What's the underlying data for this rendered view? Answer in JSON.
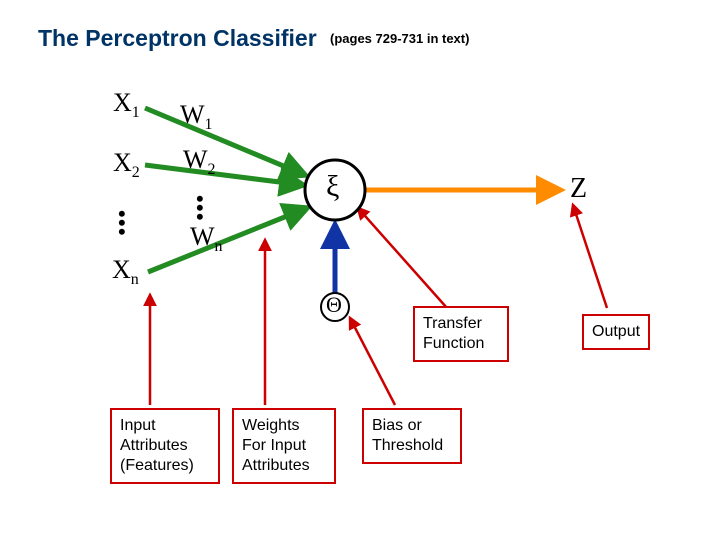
{
  "title": "The Perceptron Classifier",
  "subtitle": "(pages 729-731 in text)",
  "inputs": {
    "x1": "X",
    "x1_sub": "1",
    "x2": "X",
    "x2_sub": "2",
    "xn": "X",
    "xn_sub": "n"
  },
  "weights": {
    "w1": "W",
    "w1_sub": "1",
    "w2": "W",
    "w2_sub": "2",
    "wn": "W",
    "wn_sub": "n"
  },
  "node_symbol": "ξ",
  "bias_symbol": "Θ",
  "output_symbol": "Z",
  "boxes": {
    "inputs": "Input\nAttributes\n(Features)",
    "weights": "Weights\nFor Input\nAttributes",
    "bias": "Bias or\nThreshold",
    "transfer": "Transfer\nFunction",
    "output": "Output"
  },
  "colors": {
    "green": "#228B22",
    "orange": "#ff8c00",
    "blue": "#1034a6",
    "red": "#cc0000",
    "title": "#003366"
  }
}
